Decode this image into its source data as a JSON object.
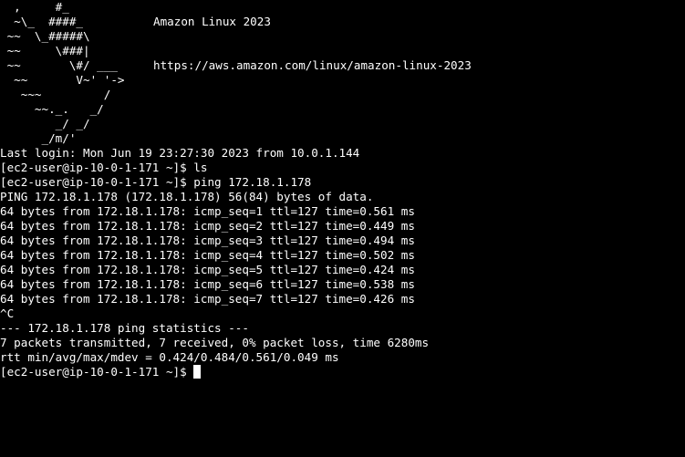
{
  "banner": {
    "logo_lines": [
      "  ,     #_",
      "  ~\\_  ####_",
      " ~~  \\_#####\\",
      " ~~     \\###|",
      " ~~       \\#/ ___",
      "  ~~       V~' '->",
      "   ~~~         /",
      "     ~~._.   _/",
      "        _/ _/",
      "      _/m/'"
    ],
    "os_name": "Amazon Linux 2023",
    "url": "https://aws.amazon.com/linux/amazon-linux-2023"
  },
  "session": {
    "last_login": "Last login: Mon Jun 19 23:27:30 2023 from 10.0.1.144",
    "lines": [
      "[ec2-user@ip-10-0-1-171 ~]$ ls",
      "[ec2-user@ip-10-0-1-171 ~]$ ping 172.18.1.178",
      "PING 172.18.1.178 (172.18.1.178) 56(84) bytes of data.",
      "64 bytes from 172.18.1.178: icmp_seq=1 ttl=127 time=0.561 ms",
      "64 bytes from 172.18.1.178: icmp_seq=2 ttl=127 time=0.449 ms",
      "64 bytes from 172.18.1.178: icmp_seq=3 ttl=127 time=0.494 ms",
      "64 bytes from 172.18.1.178: icmp_seq=4 ttl=127 time=0.502 ms",
      "64 bytes from 172.18.1.178: icmp_seq=5 ttl=127 time=0.424 ms",
      "64 bytes from 172.18.1.178: icmp_seq=6 ttl=127 time=0.538 ms",
      "64 bytes from 172.18.1.178: icmp_seq=7 ttl=127 time=0.426 ms",
      "^C",
      "--- 172.18.1.178 ping statistics ---",
      "7 packets transmitted, 7 received, 0% packet loss, time 6280ms",
      "rtt min/avg/max/mdev = 0.424/0.484/0.561/0.049 ms"
    ],
    "prompt": "[ec2-user@ip-10-0-1-171 ~]$ "
  },
  "colors": {
    "background": "#000000",
    "foreground": "#ffffff"
  }
}
